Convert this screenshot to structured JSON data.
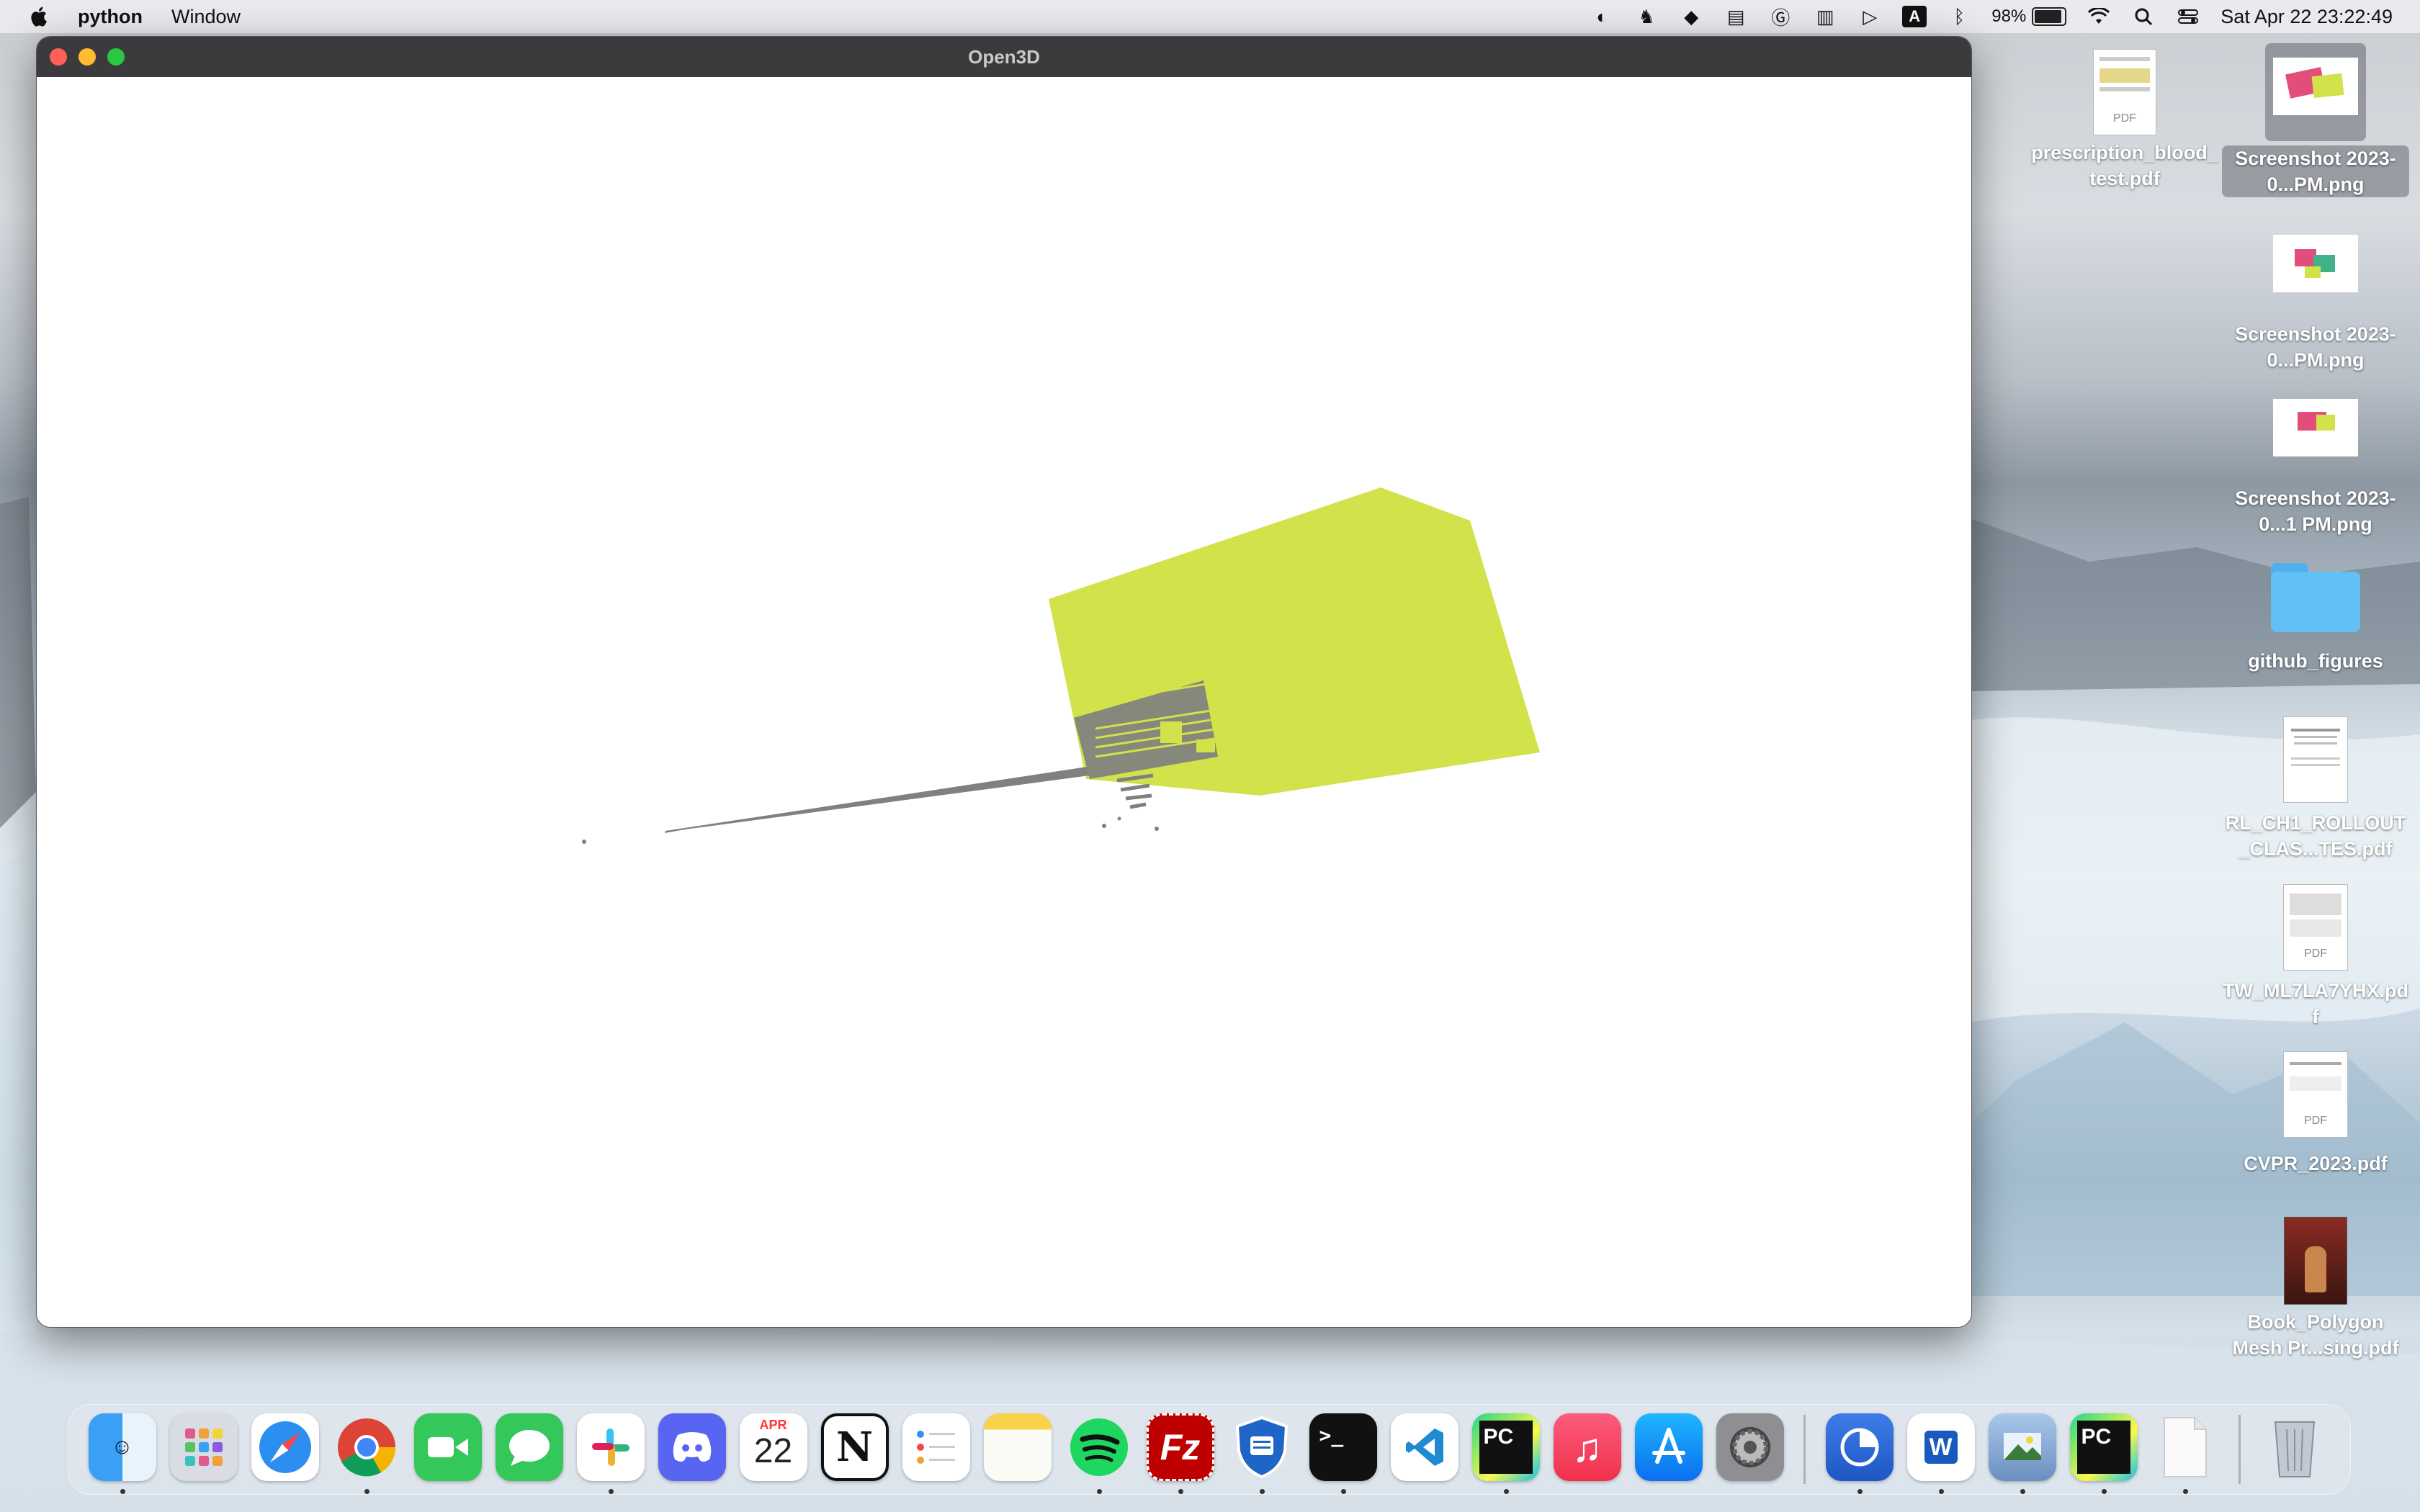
{
  "menubar": {
    "app_name": "python",
    "items": [
      "Window"
    ],
    "battery_percent": "98%",
    "battery_level": 0.98,
    "clock": "Sat Apr 22  23:22:49",
    "status_icons": [
      "night-shift-icon",
      "rabbit-icon",
      "box-icon",
      "database-icon",
      "grammarly-icon",
      "keyboard-icon",
      "play-icon",
      "input-source-a-icon",
      "bluetooth-icon",
      "wifi-icon",
      "spotlight-icon",
      "control-center-icon"
    ],
    "input_source_label": "A"
  },
  "window": {
    "title": "Open3D"
  },
  "desktop_icons": [
    {
      "label": "prescription_blood_test.pdf",
      "kind": "pdf",
      "badge": "PDF"
    },
    {
      "label": "Screenshot 2023-0...PM.png",
      "kind": "screenshot",
      "selected": true
    },
    {
      "label": "Screenshot 2023-0...PM.png",
      "kind": "screenshot"
    },
    {
      "label": "Screenshot 2023-0...1 PM.png",
      "kind": "screenshot"
    },
    {
      "label": "github_figures",
      "kind": "folder"
    },
    {
      "label": "RL_CH1_ROLLOUT_CLAS...TES.pdf",
      "kind": "pdf"
    },
    {
      "label": "TW_ML7LA7YHX.pdf",
      "kind": "pdf",
      "badge": "PDF"
    },
    {
      "label": "CVPR_2023.pdf",
      "kind": "pdf",
      "badge": "PDF"
    },
    {
      "label": "Book_Polygon Mesh Pr...sing.pdf",
      "kind": "book"
    }
  ],
  "dock": {
    "apps": [
      {
        "name": "Finder",
        "icon": "finder-icon",
        "running": true
      },
      {
        "name": "Launchpad",
        "icon": "launchpad-icon",
        "running": false
      },
      {
        "name": "Safari",
        "icon": "safari-icon",
        "running": false
      },
      {
        "name": "Chrome",
        "icon": "chrome-icon",
        "running": true
      },
      {
        "name": "FaceTime",
        "icon": "facetime-icon",
        "running": false
      },
      {
        "name": "Messages",
        "icon": "messages-icon",
        "running": false
      },
      {
        "name": "Slack",
        "icon": "slack-icon",
        "running": true
      },
      {
        "name": "Discord",
        "icon": "discord-icon",
        "running": false
      },
      {
        "name": "Calendar",
        "icon": "calendar-icon",
        "running": false,
        "month": "APR",
        "day": "22"
      },
      {
        "name": "Notion",
        "icon": "notion-icon",
        "running": false,
        "glyph": "N"
      },
      {
        "name": "Reminders",
        "icon": "reminders-icon",
        "running": false
      },
      {
        "name": "Notes",
        "icon": "notes-icon",
        "running": false
      },
      {
        "name": "Spotify",
        "icon": "spotify-icon",
        "running": true
      },
      {
        "name": "FileZilla",
        "icon": "filezilla-icon",
        "running": true,
        "glyph": "Fz"
      },
      {
        "name": "VPN",
        "icon": "shield-icon",
        "running": true
      },
      {
        "name": "Terminal",
        "icon": "terminal-icon",
        "running": true,
        "glyph": ">_"
      },
      {
        "name": "VS Code",
        "icon": "vscode-icon",
        "running": false
      },
      {
        "name": "PyCharm",
        "icon": "pycharm-icon",
        "running": true,
        "glyph": "PC"
      },
      {
        "name": "Music",
        "icon": "music-icon",
        "running": false
      },
      {
        "name": "App Store",
        "icon": "app-store-icon",
        "running": false
      },
      {
        "name": "System Settings",
        "icon": "settings-icon",
        "running": false
      }
    ],
    "recent": [
      {
        "name": "Screen Time",
        "icon": "screen-time-icon",
        "running": true
      },
      {
        "name": "Word",
        "icon": "word-icon",
        "running": true,
        "glyph": "W"
      },
      {
        "name": "Preview",
        "icon": "preview-icon",
        "running": true
      },
      {
        "name": "PyCharm",
        "icon": "pycharm-icon",
        "running": true,
        "glyph": "PC"
      },
      {
        "name": "Document",
        "icon": "document-icon",
        "running": true
      }
    ],
    "trash": {
      "name": "Trash",
      "icon": "trash-icon"
    }
  },
  "colors": {
    "mesh_fill": "#d2e24a",
    "points": "#808080",
    "titlebar": "#3b3b3d"
  }
}
